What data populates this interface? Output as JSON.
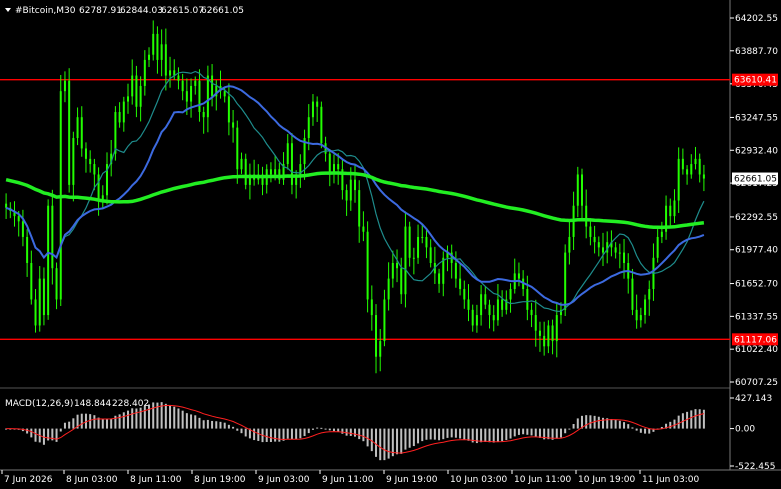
{
  "header": {
    "symbol_label": "#Bitcoin,M30",
    "ohlc": [
      "62787.91",
      "62844.03",
      "62615.07",
      "62661.05"
    ]
  },
  "macd_header": {
    "label": "MACD(12,26,9)",
    "values": [
      "148.844",
      "228.402"
    ]
  },
  "colors": {
    "background": "#000000",
    "candle": "#22ff00",
    "support_resistance": "#ff0000",
    "ma_fast": "#1e8c8c",
    "ma_mid": "#3c6ae0",
    "ma_slow": "#22ee22",
    "macd_hist": "#c0c0c0",
    "macd_signal": "#ff2020",
    "grid_tag_bg": "#ffffff"
  },
  "price_axis": {
    "ticks": [
      "64202.55",
      "63887.70",
      "63570.45",
      "63247.55",
      "62932.40",
      "62617.25",
      "62292.55",
      "61977.40",
      "61652.70",
      "61337.55",
      "61022.40",
      "60707.25"
    ],
    "level_tags": [
      {
        "name": "resistance",
        "label": "63610.41",
        "price": 63610.41
      },
      {
        "name": "current",
        "label": "62661.05",
        "price": 62661.05
      },
      {
        "name": "support",
        "label": "61117.06",
        "price": 61117.06
      }
    ]
  },
  "macd_axis": {
    "ticks": [
      "427.143",
      "0.00",
      "-522.455"
    ]
  },
  "time_axis": {
    "ticks": [
      "7 Jun 2026",
      "8 Jun 03:00",
      "8 Jun 11:00",
      "8 Jun 19:00",
      "9 Jun 03:00",
      "9 Jun 11:00",
      "9 Jun 19:00",
      "10 Jun 03:00",
      "10 Jun 11:00",
      "10 Jun 19:00",
      "11 Jun 03:00"
    ]
  },
  "chart_data": {
    "type": "candlestick",
    "price_range": [
      60707.25,
      64202.55
    ],
    "macd_range": [
      -522.455,
      427.143
    ],
    "horizontal_levels": [
      63610.41,
      61117.06
    ],
    "candles_close": [
      62380,
      62350,
      62300,
      62250,
      62100,
      61850,
      61500,
      61250,
      61700,
      61350,
      62400,
      61800,
      61500,
      63500,
      63600,
      62600,
      63050,
      63250,
      62950,
      62850,
      62800,
      62700,
      62450,
      62500,
      62800,
      62900,
      63300,
      63200,
      63400,
      63450,
      63650,
      63350,
      63550,
      63800,
      63850,
      64050,
      63800,
      63950,
      63650,
      63700,
      63650,
      63600,
      63500,
      63400,
      63550,
      63600,
      63300,
      63250,
      63650,
      63450,
      63550,
      63500,
      63450,
      63200,
      63150,
      62750,
      62850,
      62600,
      62700,
      62650,
      62700,
      62600,
      62750,
      62700,
      62750,
      62650,
      62800,
      63000,
      62600,
      62700,
      62800,
      63050,
      63250,
      63400,
      63350,
      63000,
      62900,
      62700,
      62800,
      62750,
      62550,
      62450,
      62650,
      62550,
      62200,
      62150,
      61500,
      61350,
      60950,
      61100,
      61500,
      61700,
      61850,
      61800,
      61550,
      62200,
      61900,
      61900,
      62100,
      62100,
      62000,
      61850,
      61750,
      61650,
      61900,
      61950,
      61850,
      61700,
      61600,
      61500,
      61400,
      61250,
      61350,
      61550,
      61450,
      61350,
      61300,
      61500,
      61400,
      61500,
      61600,
      61750,
      61700,
      61600,
      61400,
      61350,
      61200,
      61150,
      61050,
      61250,
      61100,
      61350,
      61400,
      61950,
      62100,
      62400,
      62700,
      62400,
      62200,
      62100,
      62050,
      62000,
      61950,
      62050,
      62000,
      61950,
      61950,
      61850,
      61700,
      61400,
      61300,
      61350,
      61500,
      61600,
      61900,
      62100,
      62150,
      62400,
      62300,
      62450,
      62850,
      62750,
      62700,
      62800,
      62850,
      62700,
      62661
    ]
  }
}
